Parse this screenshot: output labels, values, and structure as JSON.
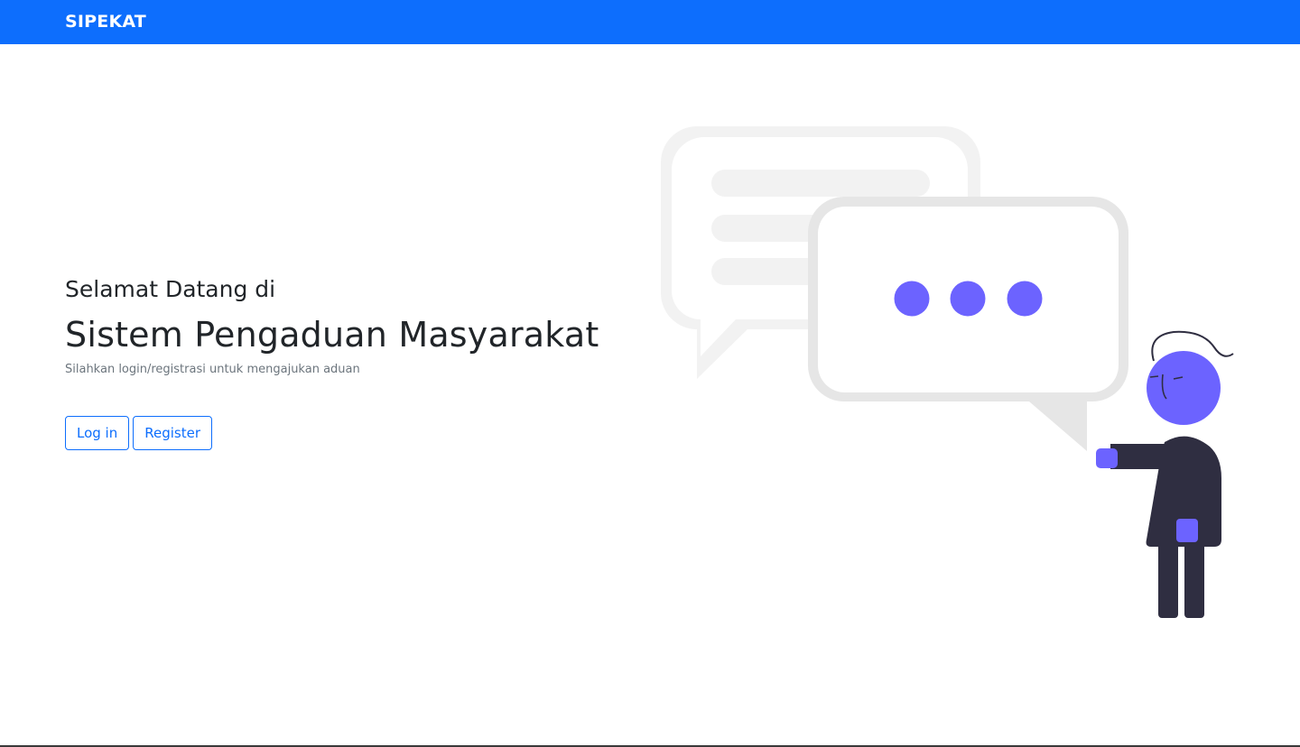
{
  "navbar": {
    "brand": "SIPEKAT",
    "color": "#0d6efd"
  },
  "hero": {
    "welcome": "Selamat Datang di",
    "title": "Sistem Pengaduan Masyarakat",
    "subtitle": "Silahkan login/registrasi untuk mengajukan aduan"
  },
  "actions": {
    "login_label": "Log in",
    "register_label": "Register"
  },
  "illustration": {
    "accent_color": "#6c63ff",
    "dark_color": "#2f2e41",
    "bubble_color": "#e6e6e6",
    "icon": "chat-conversation-illustration"
  }
}
